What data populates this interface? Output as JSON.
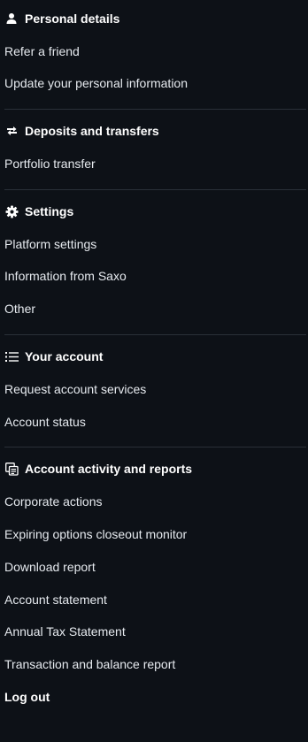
{
  "sections": [
    {
      "title": "Personal details",
      "icon": "user-icon",
      "items": [
        "Refer a friend",
        "Update your personal information"
      ]
    },
    {
      "title": "Deposits and transfers",
      "icon": "transfer-arrows-icon",
      "items": [
        "Portfolio transfer"
      ]
    },
    {
      "title": "Settings",
      "icon": "gear-icon",
      "items": [
        "Platform settings",
        "Information from Saxo",
        "Other"
      ]
    },
    {
      "title": "Your account",
      "icon": "list-icon",
      "items": [
        "Request account services",
        "Account status"
      ]
    },
    {
      "title": "Account activity and reports",
      "icon": "reports-icon",
      "items": [
        "Corporate actions",
        "Expiring options closeout monitor",
        "Download report",
        "Account statement",
        "Annual Tax Statement",
        "Transaction and balance report"
      ]
    }
  ],
  "logout": "Log out",
  "colors": {
    "background": "#0d1117",
    "text": "#e6eaef",
    "divider": "#2a3038"
  }
}
